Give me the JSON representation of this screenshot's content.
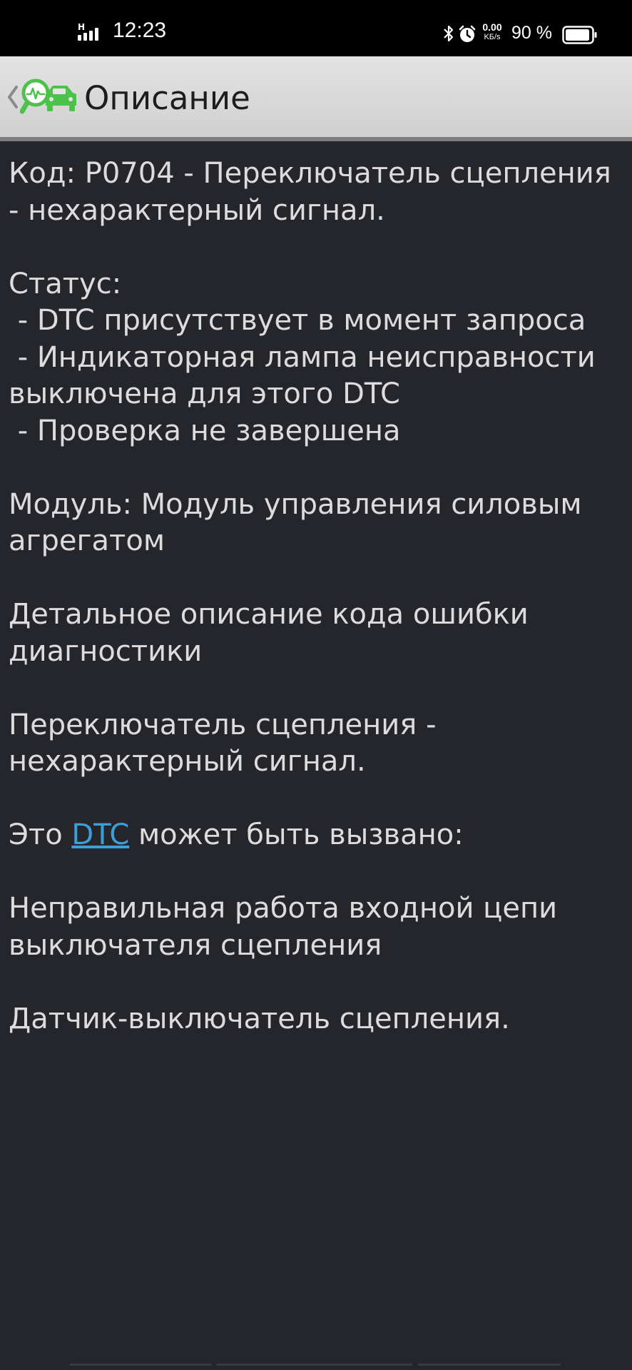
{
  "status_bar": {
    "network_type": "H",
    "time": "12:23",
    "speed_value": "0.00",
    "speed_unit": "KБ/s",
    "battery_percent": "90 %",
    "icons": [
      "signal-icon",
      "bluetooth-icon",
      "alarm-icon",
      "battery-icon"
    ]
  },
  "header": {
    "title": "Описание",
    "logo_icon": "car-diagnostics-logo",
    "back_icon": "chevron-left-icon",
    "accent_color": "#4cc24a"
  },
  "content": {
    "code_line": "Код: P0704 - Переключатель сцепления - нехарактерный сигнал.",
    "status_heading": "Статус:",
    "status_items": [
      " - DTC присутствует в момент запроса",
      " - Индикаторная лампа неисправности выключена для этого DTC",
      " - Проверка не завершена"
    ],
    "module_line": "Модуль: Модуль управления силовым агрегатом",
    "detail_heading": "Детальное описание кода ошибки диагностики",
    "detail_text": "Переключатель сцепления - нехарактерный сигнал.",
    "cause_prefix": "Это ",
    "cause_link": "DTC",
    "cause_suffix": " может быть вызвано:",
    "causes": [
      "Неправильная работа входной цепи выключателя сцепления",
      "Датчик-выключатель сцепления."
    ],
    "link_color": "#3d9fd8",
    "text_color": "#dcdcdc",
    "background_color": "#25262c"
  }
}
